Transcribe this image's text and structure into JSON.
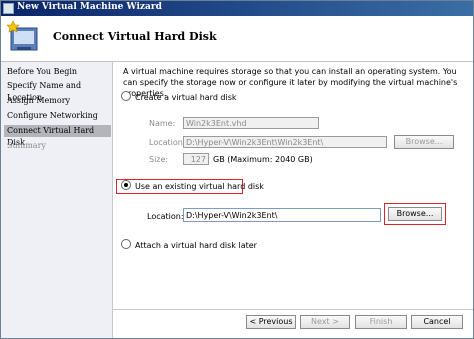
{
  "window": {
    "title": "New Virtual Machine Wizard"
  },
  "header": {
    "title": "Connect Virtual Hard Disk",
    "icon": "virtual-disk-wizard-icon"
  },
  "nav": {
    "items": [
      {
        "label": "Before You Begin",
        "state": "normal"
      },
      {
        "label": "Specify Name and Location",
        "state": "normal"
      },
      {
        "label": "Assign Memory",
        "state": "normal"
      },
      {
        "label": "Configure Networking",
        "state": "normal"
      },
      {
        "label": "Connect Virtual Hard Disk",
        "state": "active"
      },
      {
        "label": "Summary",
        "state": "disabled"
      }
    ]
  },
  "main": {
    "description": "A virtual machine requires storage so that you can install an operating system. You can specify the storage now or configure it later by modifying the virtual machine's properties.",
    "create_option": {
      "label": "Create a virtual hard disk",
      "selected": false,
      "name_label": "Name:",
      "name_value": "Win2k3Ent.vhd",
      "location_label": "Location:",
      "location_value": "D:\\Hyper-V\\Win2k3Ent\\Win2k3Ent\\",
      "browse_label": "Browse...",
      "size_label": "Size:",
      "size_value": "127",
      "size_unit": "GB (Maximum: 2040 GB)"
    },
    "existing_option": {
      "label": "Use an existing virtual hard disk",
      "selected": true,
      "location_label": "Location:",
      "location_value": "D:\\Hyper-V\\Win2k3Ent\\",
      "browse_label": "Browse..."
    },
    "later_option": {
      "label": "Attach a virtual hard disk later",
      "selected": false
    }
  },
  "footer": {
    "previous": "< Previous",
    "next": "Next >",
    "finish": "Finish",
    "cancel": "Cancel"
  },
  "colors": {
    "highlight": "#d9262e",
    "titlebar": "#0a246a",
    "nav_bg": "#eff0f5"
  }
}
